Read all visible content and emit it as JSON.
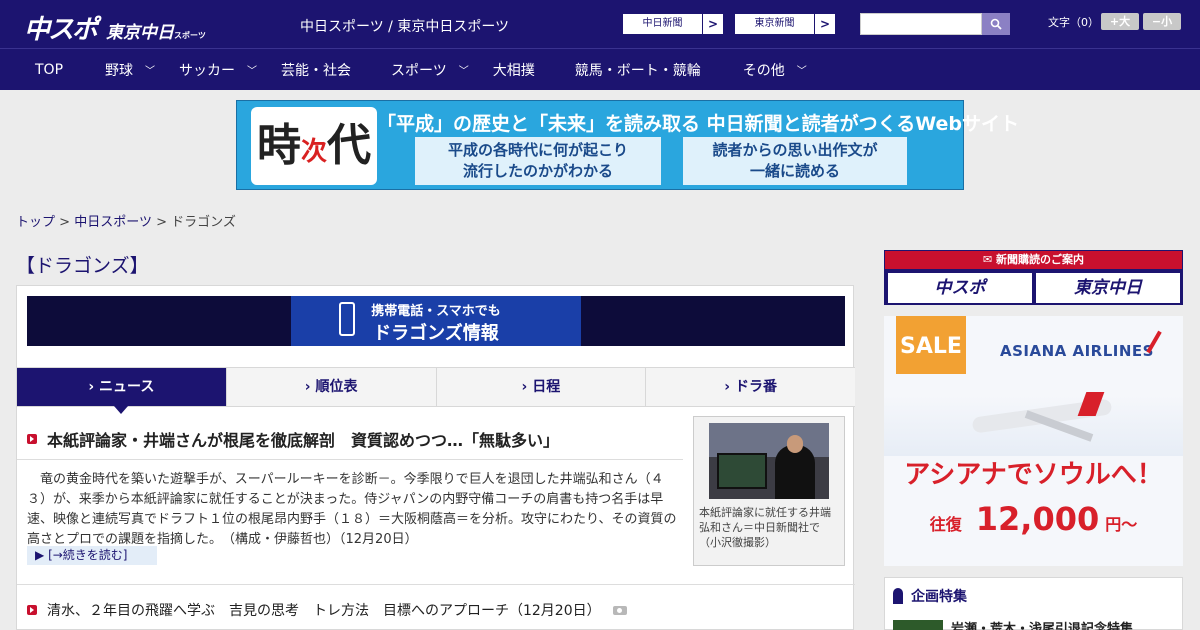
{
  "header": {
    "logo_main": "中スポ",
    "logo_sub": "東京中日",
    "logo_tiny": "スポーツ",
    "site_title": "中日スポーツ / 東京中日スポーツ",
    "paper_links": [
      {
        "label": "中日新聞",
        "arrow": ">"
      },
      {
        "label": "東京新聞",
        "arrow": ">"
      }
    ],
    "search": {
      "placeholder": "",
      "button_icon": "search-icon"
    },
    "font_size": {
      "label": "文字（0）",
      "bigger": "+大",
      "smaller": "−小"
    }
  },
  "nav": {
    "items": [
      {
        "label": "TOP",
        "has_menu": false
      },
      {
        "label": "野球",
        "has_menu": true
      },
      {
        "label": "サッカー",
        "has_menu": true
      },
      {
        "label": "芸能・社会",
        "has_menu": false
      },
      {
        "label": "スポーツ",
        "has_menu": true
      },
      {
        "label": "大相撲",
        "has_menu": false
      },
      {
        "label": "競馬・ボート・競輪",
        "has_menu": false
      },
      {
        "label": "その他",
        "has_menu": true
      }
    ]
  },
  "banner": {
    "kanji_1": "時",
    "kanji_2": "次",
    "kanji_3": "代",
    "headline": "「平成」の歴史と「未来」を読み取る 中日新聞と読者がつくるWebサイト",
    "box_left_1": "平成の各時代に何が起こり",
    "box_left_2": "流行したのかがわかる",
    "box_right_1": "読者からの思い出作文が",
    "box_right_2": "一緒に読める"
  },
  "breadcrumb": {
    "items": [
      "トップ",
      "中日スポーツ"
    ],
    "separator": ">",
    "current": "ドラゴンズ"
  },
  "section": {
    "title": "【ドラゴンズ】"
  },
  "mobile_banner": {
    "line1": "携帯電話・スマホでも",
    "line2": "ドラゴンズ情報"
  },
  "tabs": [
    {
      "label": "ニュース",
      "active": true
    },
    {
      "label": "順位表",
      "active": false
    },
    {
      "label": "日程",
      "active": false
    },
    {
      "label": "ドラ番",
      "active": false
    }
  ],
  "lead": {
    "headline": "本紙評論家・井端さんが根尾を徹底解剖　資質認めつつ…「無駄多い」",
    "body": "竜の黄金時代を築いた遊撃手が、スーパールーキーを診断－。今季限りで巨人を退団した井端弘和さん（４３）が、来季から本紙評論家に就任することが決まった。侍ジャパンの内野守備コーチの肩書も持つ名手は早速、映像と連続写真でドラフト１位の根尾昂内野手（１８）＝大阪桐蔭高＝を分析。攻守にわたり、その資質の高さとプロでの課題を指摘した。　（構成・伊藤哲也）（12月20日）",
    "read_more": "[→続きを読む]",
    "photo_caption": "本紙評論家に就任する井端弘和さん＝中日新聞社で（小沢徹撮影）"
  },
  "news_list": [
    {
      "title": "清水、２年目の飛躍へ学ぶ　吉見の思考　トレ方法　目標へのアプローチ（12月20日）",
      "has_photo": true
    }
  ],
  "sidebar": {
    "subscribe_head": "新聞購読のご案内",
    "subscribe_left": "中スポ",
    "subscribe_right": "東京中日",
    "ad": {
      "sale": "SALE",
      "airline": "ASIANA AIRLINES",
      "catch": "アシアナでソウルへ！",
      "fare_label": "往復",
      "fare": "12,000",
      "fare_unit": "円〜"
    },
    "feature_title": "企画特集",
    "feature_line": "岩瀬・荒木・浅尾引退記念特集"
  },
  "colors": {
    "brand_navy": "#1c1470",
    "accent_red": "#c8102e",
    "banner_blue": "#2aa6de"
  }
}
